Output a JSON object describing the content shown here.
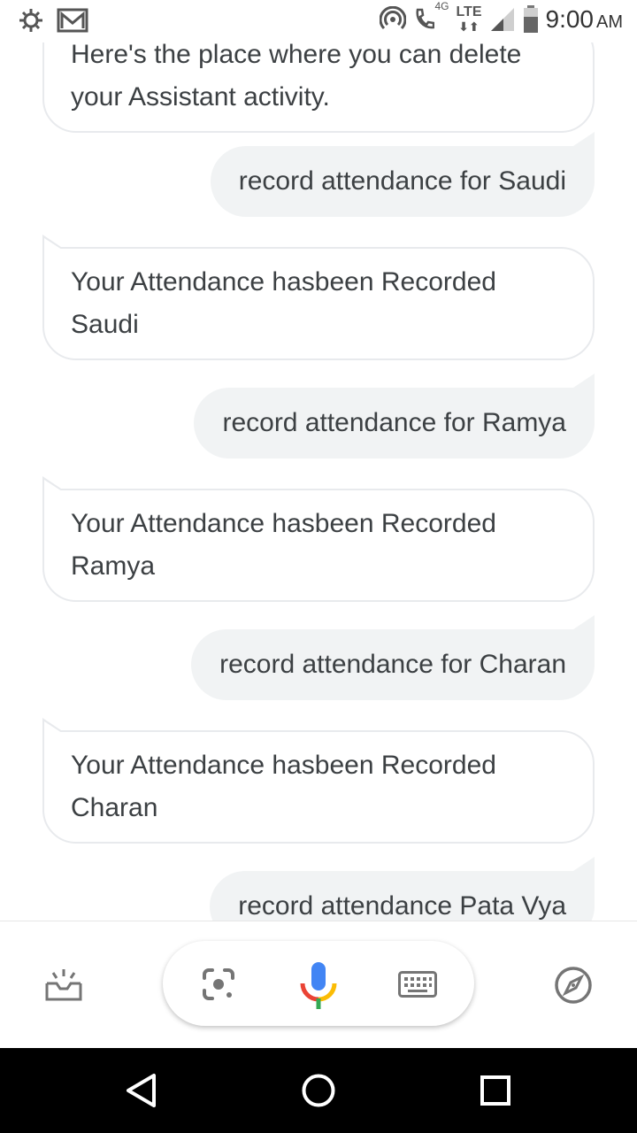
{
  "status_bar": {
    "time": "9:00",
    "ampm": "AM",
    "network": "LTE",
    "call_tag": "4G"
  },
  "chat": {
    "messages": [
      {
        "from": "assistant",
        "text": "Here's the place where you can delete your Assistant activity."
      },
      {
        "from": "user",
        "text": "record attendance for Saudi"
      },
      {
        "from": "assistant",
        "text": "Your Attendance hasbeen Recorded Saudi"
      },
      {
        "from": "user",
        "text": "record attendance for Ramya"
      },
      {
        "from": "assistant",
        "text": "Your Attendance hasbeen Recorded Ramya"
      },
      {
        "from": "user",
        "text": "record attendance for Charan"
      },
      {
        "from": "assistant",
        "text": "Your Attendance hasbeen Recorded Charan"
      },
      {
        "from": "user",
        "text": "record attendance Pata Vya"
      }
    ]
  },
  "bottom_bar": {
    "left_icon": "snapshot-tray-icon",
    "lens_icon": "google-lens-icon",
    "mic_icon": "microphone-icon",
    "keyboard_icon": "keyboard-icon",
    "explore_icon": "compass-icon"
  },
  "nav_bar": {
    "back_icon": "back-triangle-icon",
    "home_icon": "home-circle-icon",
    "recents_icon": "recents-square-icon"
  },
  "colors": {
    "user_bubble": "#f1f3f4",
    "bot_border": "#e8eaed",
    "text": "#3c4043",
    "mic_blue": "#4285f4",
    "mic_red": "#ea4335",
    "mic_yellow": "#fbbc05",
    "mic_green": "#34a853"
  }
}
